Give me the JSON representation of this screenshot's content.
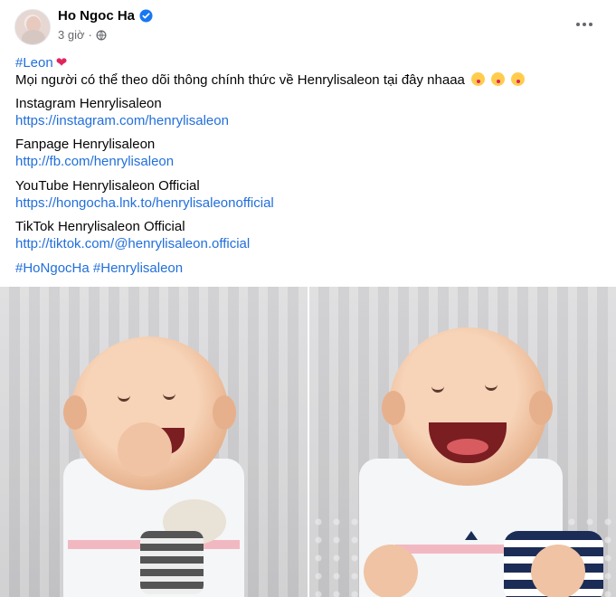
{
  "post": {
    "author": "Ho Ngoc Ha",
    "time": "3 giờ",
    "separator": "·",
    "icons": {
      "verified": "verified-badge-icon",
      "audience": "globe-icon",
      "more": "more-options-icon"
    },
    "accent_color": "#216fdb"
  },
  "content": {
    "tag_leon": "#Leon",
    "intro": "Mọi người có thể theo dõi thông chính thức về Henrylisaleon tại đây nhaaa",
    "sections": [
      {
        "title": "Instagram Henrylisaleon",
        "url": "https://instagram.com/henrylisaleon"
      },
      {
        "title": "Fanpage Henrylisaleon",
        "url": "http://fb.com/henrylisaleon"
      },
      {
        "title": "YouTube Henrylisaleon Official",
        "url": "https://hongocha.lnk.to/henrylisaleonofficial"
      },
      {
        "title": "TikTok Henrylisaleon Official",
        "url": "http://tiktok.com/@henrylisaleon.official"
      }
    ],
    "hashtags": [
      "#HoNgocHa",
      "#Henrylisaleon"
    ]
  }
}
